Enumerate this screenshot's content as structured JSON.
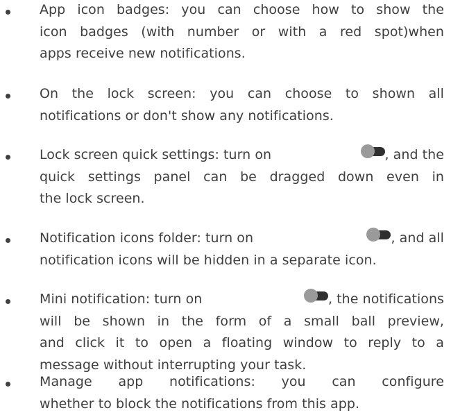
{
  "items": [
    {
      "lines": [
        "App icon badges: you can choose how to show the",
        "icon badges (with number or with a red spot)when",
        "apps receive new notifications."
      ]
    },
    {
      "lines": [
        "On the lock screen: you can choose to shown all",
        "notifications or don't show any notifications."
      ]
    },
    {
      "line1_before": "Lock screen quick settings: turn on",
      "line1_after": ", and the",
      "lines": [
        "quick settings panel can be dragged down even in",
        "the lock screen."
      ]
    },
    {
      "line1_before": "Notification icons folder: turn on",
      "line1_after": ", and all",
      "lines": [
        "notification icons will be hidden in a separate icon."
      ]
    },
    {
      "line1_before": "Mini notification: turn on",
      "line1_after": ", the notifications",
      "lines": [
        "will be shown in the form of a small ball preview,",
        "and click it to open a floating window to reply to a",
        "message  without interrupting your task."
      ]
    },
    {
      "lines": [
        "Manage app notifications: you can configure",
        "whether to block the notifications from this app."
      ]
    }
  ],
  "toggle_icon": "toggle-switch-icon",
  "colors": {
    "text": "#3f3f3f",
    "toggle_track": "#2f2f2f",
    "toggle_knob": "#9a9a9a"
  }
}
